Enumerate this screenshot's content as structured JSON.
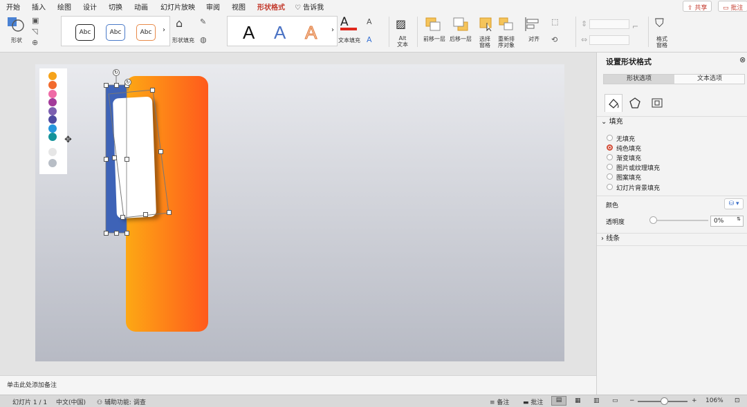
{
  "menu": {
    "tabs": [
      "开始",
      "插入",
      "绘图",
      "设计",
      "切换",
      "动画",
      "幻灯片放映",
      "审阅",
      "视图",
      "形状格式"
    ],
    "tell_me": "告诉我",
    "share": "共享",
    "comment": "批注"
  },
  "ribbon": {
    "shape_label": "形状",
    "style_samples": [
      "Abc",
      "Abc",
      "Abc"
    ],
    "shape_fill_label": "形状填充",
    "wordart_samples": [
      "A",
      "A",
      "A"
    ],
    "text_fill_label": "文本填充",
    "alt_text_label": "Alt\n文本",
    "bring_forward": "前移一层",
    "send_backward": "后移一层",
    "selection_pane": "选择\n窗格",
    "reorder_objects": "重新排\n序对象",
    "align": "对齐",
    "format_pane": "格式\n窗格"
  },
  "notes": {
    "placeholder": "单击此处添加备注"
  },
  "palette": {
    "colors": [
      "#f6a31a",
      "#f26a2d",
      "#ef6aa6",
      "#a33a9a",
      "#7c5fb0",
      "#4f4aa0",
      "#2596dc",
      "#14939a",
      "#e6e6e6",
      "#b8bec6"
    ]
  },
  "format_pane": {
    "title": "设置形状格式",
    "tabs": [
      "形状选项",
      "文本选项"
    ],
    "fill_section": "填充",
    "fill_options": [
      {
        "label": "无填充",
        "selected": false
      },
      {
        "label": "纯色填充",
        "selected": true
      },
      {
        "label": "渐变填充",
        "selected": false
      },
      {
        "label": "图片或纹理填充",
        "selected": false
      },
      {
        "label": "图案填充",
        "selected": false
      },
      {
        "label": "幻灯片背景填充",
        "selected": false
      }
    ],
    "color_label": "颜色",
    "transparency_label": "透明度",
    "transparency_value": "0%",
    "line_section": "线条"
  },
  "status": {
    "slide_counter": "幻灯片 1 / 1",
    "language": "中文(中国)",
    "accessibility": "辅助功能: 调查",
    "notes": "备注",
    "comments": "批注",
    "zoom": "106%"
  }
}
